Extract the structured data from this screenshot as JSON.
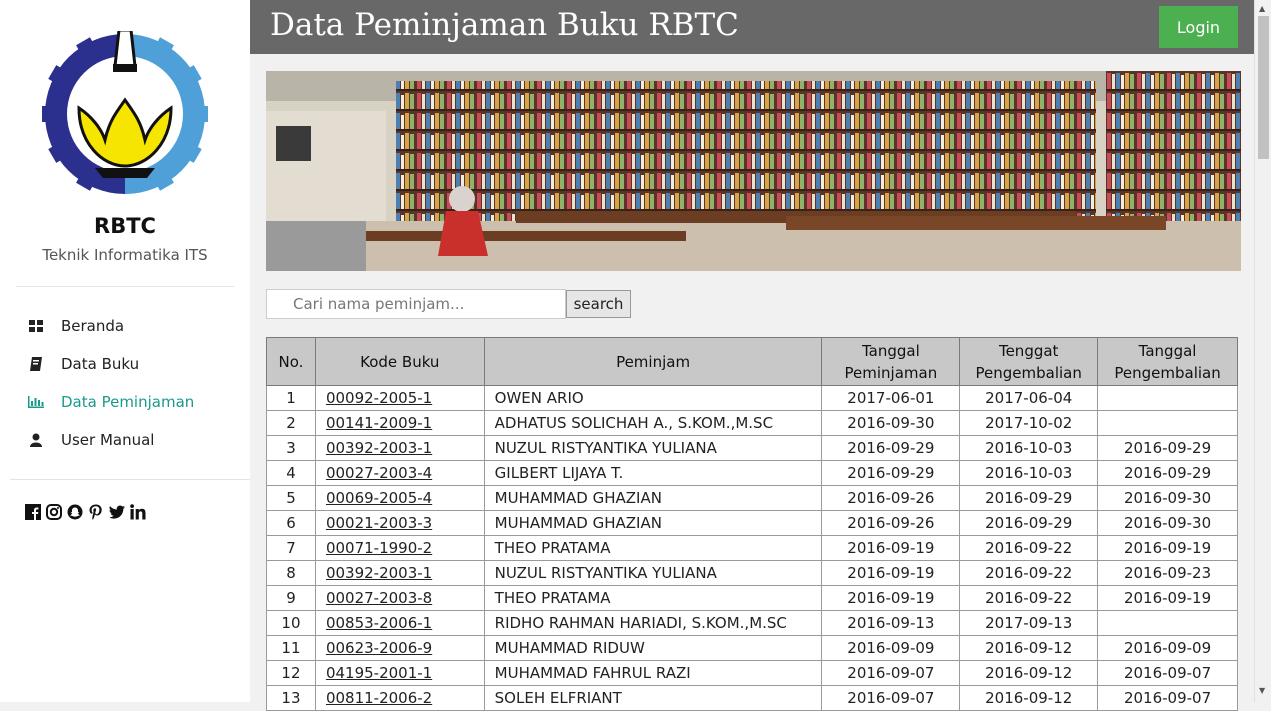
{
  "sidebar": {
    "brand": "RBTC",
    "subtitle": "Teknik Informatika ITS",
    "nav": [
      {
        "label": "Beranda",
        "icon": "dashboard-icon"
      },
      {
        "label": "Data Buku",
        "icon": "book-icon"
      },
      {
        "label": "Data Peminjaman",
        "icon": "bar-chart-icon"
      },
      {
        "label": "User Manual",
        "icon": "user-icon"
      }
    ],
    "social": [
      "facebook-icon",
      "instagram-icon",
      "snapchat-icon",
      "pinterest-icon",
      "twitter-icon",
      "linkedin-icon"
    ]
  },
  "header": {
    "title": "Data Peminjaman Buku RBTC",
    "login_label": "Login"
  },
  "search": {
    "placeholder": "Cari nama peminjam...",
    "button_label": "search"
  },
  "colors": {
    "accent": "#1a9a8b",
    "login": "#4cb050",
    "topbar": "#686868"
  },
  "table": {
    "headers": [
      "No.",
      "Kode Buku",
      "Peminjam",
      "Tanggal Peminjaman",
      "Tenggat Pengembalian",
      "Tanggal Pengembalian"
    ],
    "rows": [
      [
        "1",
        "00092-2005-1",
        "OWEN ARIO",
        "2017-06-01",
        "2017-06-04",
        ""
      ],
      [
        "2",
        "00141-2009-1",
        "ADHATUS SOLICHAH A., S.KOM.,M.SC",
        "2016-09-30",
        "2017-10-02",
        ""
      ],
      [
        "3",
        "00392-2003-1",
        "NUZUL RISTYANTIKA YULIANA",
        "2016-09-29",
        "2016-10-03",
        "2016-09-29"
      ],
      [
        "4",
        "00027-2003-4",
        "GILBERT LIJAYA T.",
        "2016-09-29",
        "2016-10-03",
        "2016-09-29"
      ],
      [
        "5",
        "00069-2005-4",
        "MUHAMMAD GHAZIAN",
        "2016-09-26",
        "2016-09-29",
        "2016-09-30"
      ],
      [
        "6",
        "00021-2003-3",
        "MUHAMMAD GHAZIAN",
        "2016-09-26",
        "2016-09-29",
        "2016-09-30"
      ],
      [
        "7",
        "00071-1990-2",
        "THEO PRATAMA",
        "2016-09-19",
        "2016-09-22",
        "2016-09-19"
      ],
      [
        "8",
        "00392-2003-1",
        "NUZUL RISTYANTIKA YULIANA",
        "2016-09-19",
        "2016-09-22",
        "2016-09-23"
      ],
      [
        "9",
        "00027-2003-8",
        "THEO PRATAMA",
        "2016-09-19",
        "2016-09-22",
        "2016-09-19"
      ],
      [
        "10",
        "00853-2006-1",
        "RIDHO RAHMAN HARIADI, S.KOM.,M.SC",
        "2016-09-13",
        "2017-09-13",
        ""
      ],
      [
        "11",
        "00623-2006-9",
        "MUHAMMAD RIDUW",
        "2016-09-09",
        "2016-09-12",
        "2016-09-09"
      ],
      [
        "12",
        "04195-2001-1",
        "MUHAMMAD FAHRUL RAZI",
        "2016-09-07",
        "2016-09-12",
        "2016-09-07"
      ],
      [
        "13",
        "00811-2006-2",
        "SOLEH ELFRIANT",
        "2016-09-07",
        "2016-09-12",
        "2016-09-07"
      ]
    ]
  }
}
